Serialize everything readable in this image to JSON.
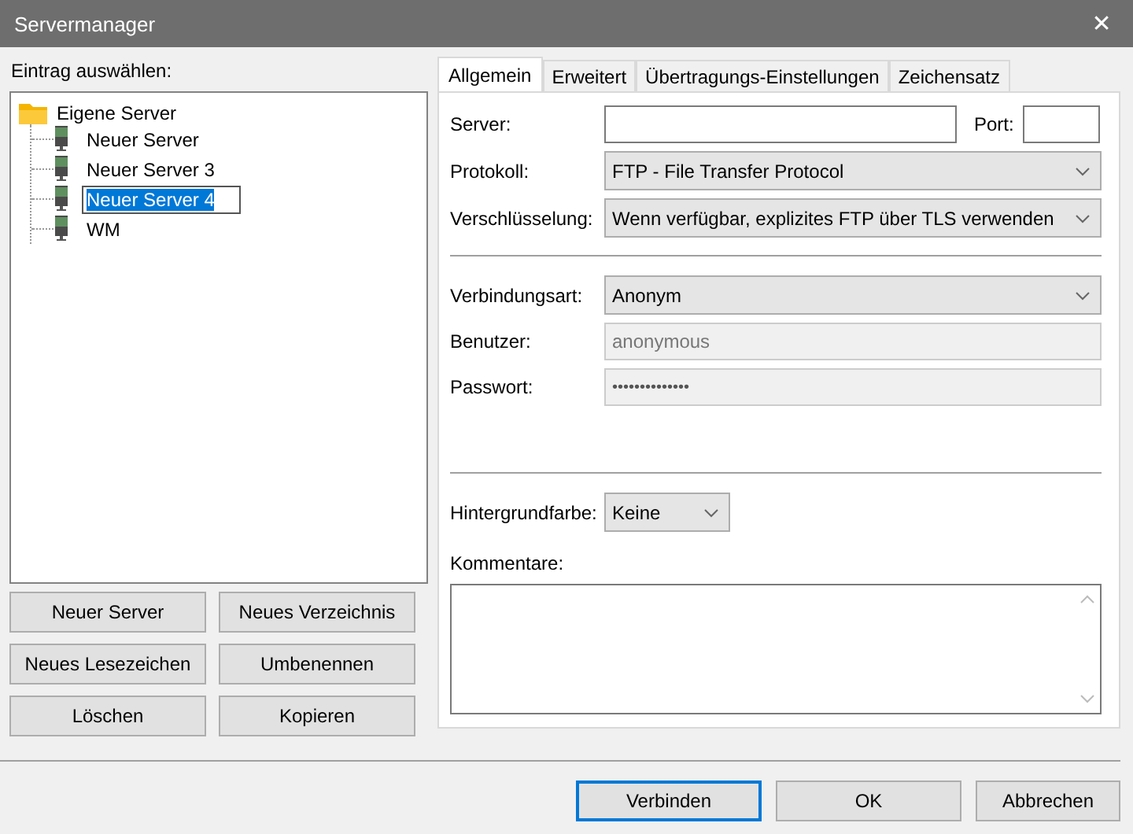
{
  "window": {
    "title": "Servermanager",
    "close": "✕"
  },
  "entry_label": "Eintrag auswählen:",
  "tree": {
    "label": "Eigene Server",
    "kind": "folder",
    "expanded": true,
    "selected": false,
    "children": [
      {
        "label": "Neuer Server",
        "kind": "server",
        "selected": false
      },
      {
        "label": "Neuer Server 3",
        "kind": "server",
        "selected": false
      },
      {
        "label": "Neuer Server 4",
        "kind": "server",
        "selected": true
      },
      {
        "label": "WM",
        "kind": "server",
        "selected": false
      }
    ]
  },
  "tree_buttons": [
    "Neuer Server",
    "Neues Verzeichnis",
    "Neues Lesezeichen",
    "Umbenennen",
    "Löschen",
    "Kopieren"
  ],
  "tabs": [
    {
      "label": "Allgemein",
      "selected": true
    },
    {
      "label": "Erweitert",
      "selected": false
    },
    {
      "label": "Übertragungs-Einstellungen",
      "selected": false
    },
    {
      "label": "Zeichensatz",
      "selected": false
    }
  ],
  "server": {
    "label": "Server:",
    "port_label": "Port:"
  },
  "protocol": {
    "label": "Protokoll:",
    "value": "FTP - File Transfer Protocol"
  },
  "encryption": {
    "label": "Verschlüsselung:",
    "value": "Wenn verfügbar, explizites FTP über TLS verwenden"
  },
  "logon_type": {
    "label": "Verbindungsart:",
    "value": "Anonym"
  },
  "user": {
    "label": "Benutzer:",
    "value": "anonymous",
    "disabled": true
  },
  "password": {
    "label": "Passwort:",
    "value": "••••••••••••••",
    "disabled": true
  },
  "background_color": {
    "label": "Hintergrundfarbe:",
    "value": "Keine"
  },
  "comments": {
    "label": "Kommentare:"
  },
  "buttons": [
    {
      "label": "Verbinden",
      "default": true
    },
    {
      "label": "OK",
      "default": false
    },
    {
      "label": "Abbrechen",
      "default": false
    }
  ]
}
